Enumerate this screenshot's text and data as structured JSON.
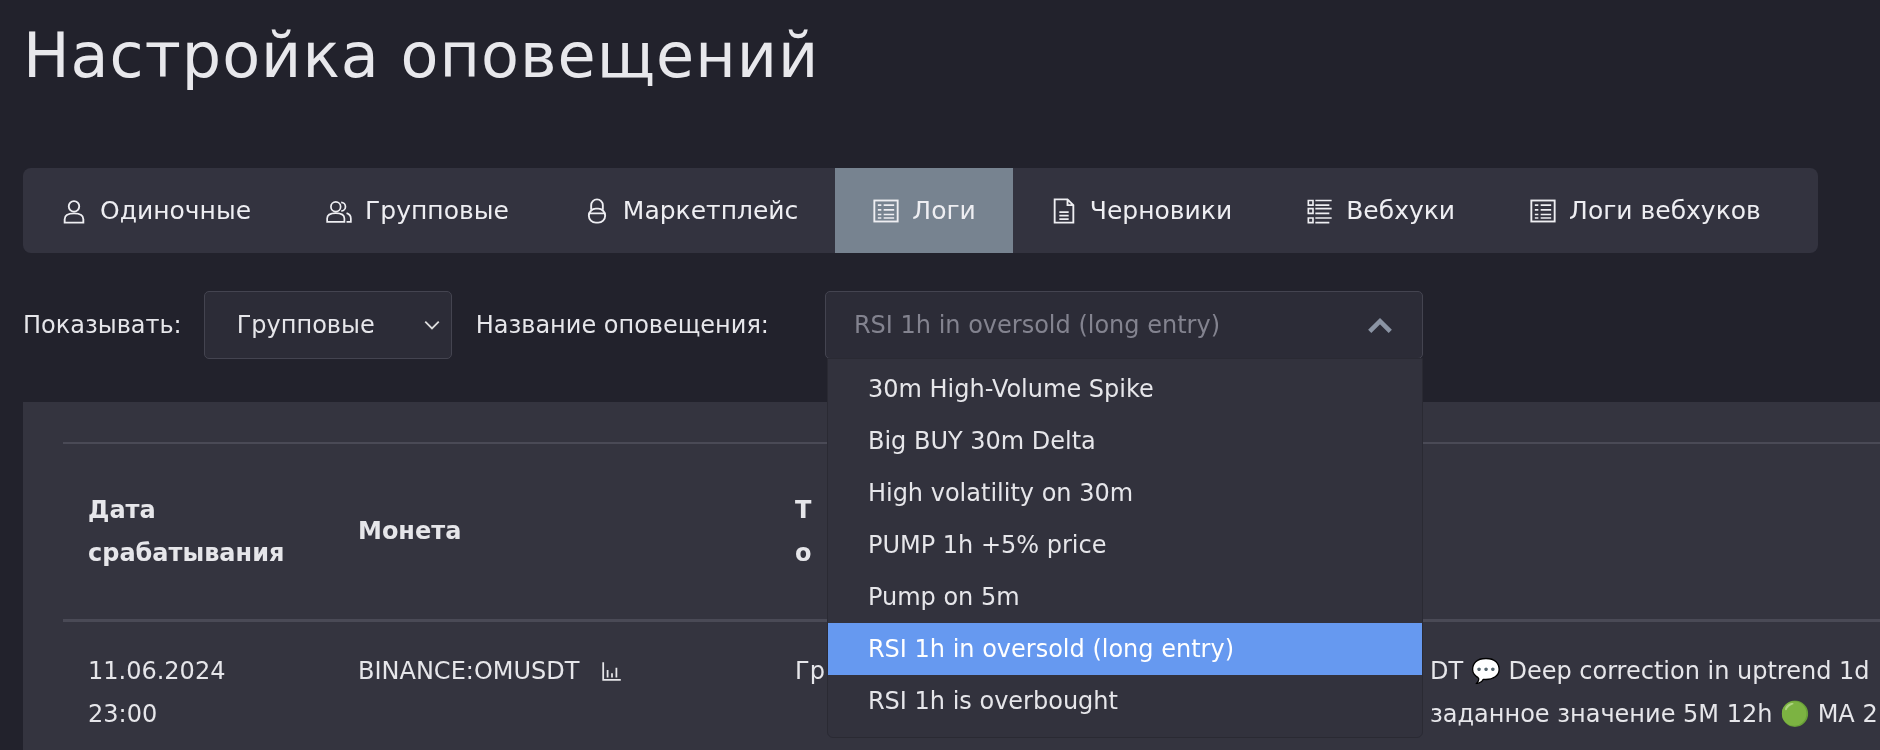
{
  "page": {
    "title": "Настройка оповещений"
  },
  "tabs": [
    {
      "label": "Одиночные",
      "kind": "user",
      "selected": false
    },
    {
      "label": "Групповые",
      "kind": "users",
      "selected": false
    },
    {
      "label": "Маркетплейс",
      "kind": "lock",
      "selected": false
    },
    {
      "label": "Логи",
      "kind": "table",
      "selected": true
    },
    {
      "label": "Черновики",
      "kind": "file",
      "selected": false
    },
    {
      "label": "Вебхуки",
      "kind": "list",
      "selected": false
    },
    {
      "label": "Логи вебхуков",
      "kind": "table",
      "selected": false
    }
  ],
  "filters": {
    "show_label": "Показывать:",
    "show_value": "Групповые",
    "name_label": "Название оповещения:",
    "name_value": "RSI 1h in oversold (long entry)",
    "expanded": true
  },
  "dropdown": [
    {
      "label": "30m High-Volume Spike",
      "selected": false
    },
    {
      "label": "Big BUY 30m Delta",
      "selected": false
    },
    {
      "label": "High volatility on 30m",
      "selected": false
    },
    {
      "label": "PUMP 1h +5% price",
      "selected": false
    },
    {
      "label": "Pump on 5m",
      "selected": false
    },
    {
      "label": "RSI 1h in oversold (long entry)",
      "selected": true
    },
    {
      "label": "RSI 1h is overbought",
      "selected": false
    }
  ],
  "table": {
    "columns": [
      {
        "label": "Дата срабатывания"
      },
      {
        "label": "Монета"
      },
      {
        "label": "Т о"
      }
    ],
    "rows": [
      {
        "date": "11.06.2024 23:00",
        "coin": "BINANCE:OMUSDT",
        "column_3": "Гр",
        "message_lines": [
          "DT 💬 Deep correction in uptrend 1d",
          "заданное значение 5M 12h 🟢 MA 2"
        ]
      }
    ]
  }
}
